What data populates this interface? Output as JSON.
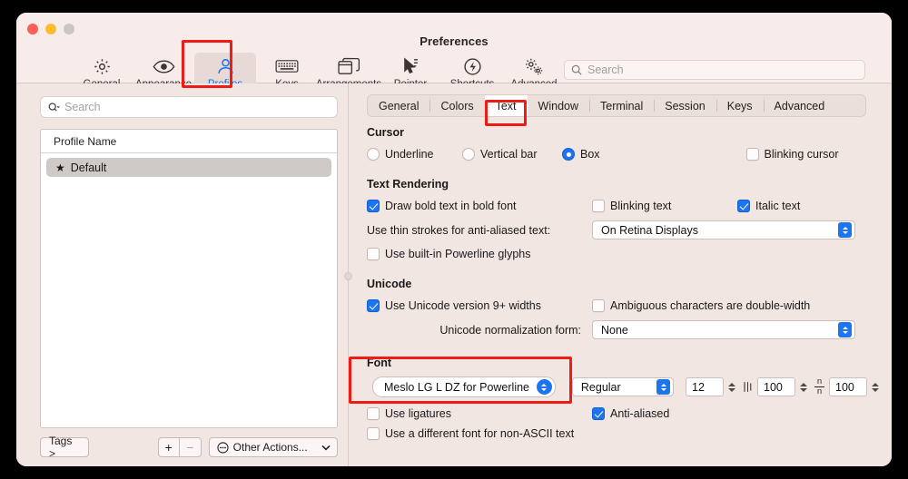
{
  "window": {
    "title": "Preferences",
    "traffic_lights": [
      "close",
      "minimize",
      "zoom"
    ]
  },
  "toolbar": {
    "items": [
      {
        "label": "General",
        "icon": "gear-icon",
        "selected": false
      },
      {
        "label": "Appearance",
        "icon": "eye-icon",
        "selected": false
      },
      {
        "label": "Profiles",
        "icon": "person-icon",
        "selected": true
      },
      {
        "label": "Keys",
        "icon": "keyboard-icon",
        "selected": false
      },
      {
        "label": "Arrangements",
        "icon": "windows-icon",
        "selected": false
      },
      {
        "label": "Pointer",
        "icon": "cursor-icon",
        "selected": false
      },
      {
        "label": "Shortcuts",
        "icon": "bolt-icon",
        "selected": false
      },
      {
        "label": "Advanced",
        "icon": "gears-icon",
        "selected": false
      }
    ],
    "search": {
      "placeholder": "Search",
      "value": "",
      "caption": "Search"
    }
  },
  "sidebar": {
    "search": {
      "placeholder": "Search",
      "value": ""
    },
    "table": {
      "column_header": "Profile Name",
      "rows": [
        {
          "name": "Default",
          "starred": true,
          "selected": true
        }
      ]
    },
    "buttons": {
      "tags": "Tags >",
      "add": "+",
      "remove": "−",
      "other_actions": "Other Actions..."
    }
  },
  "main": {
    "tabs": [
      {
        "label": "General",
        "active": false
      },
      {
        "label": "Colors",
        "active": false
      },
      {
        "label": "Text",
        "active": true
      },
      {
        "label": "Window",
        "active": false
      },
      {
        "label": "Terminal",
        "active": false
      },
      {
        "label": "Session",
        "active": false
      },
      {
        "label": "Keys",
        "active": false
      },
      {
        "label": "Advanced",
        "active": false
      }
    ],
    "cursor": {
      "title": "Cursor",
      "options": [
        {
          "label": "Underline",
          "checked": false
        },
        {
          "label": "Vertical bar",
          "checked": false
        },
        {
          "label": "Box",
          "checked": true
        }
      ],
      "blinking": {
        "label": "Blinking cursor",
        "checked": false
      }
    },
    "text_rendering": {
      "title": "Text Rendering",
      "bold": {
        "label": "Draw bold text in bold font",
        "checked": true
      },
      "blinking_text": {
        "label": "Blinking text",
        "checked": false
      },
      "italic_text": {
        "label": "Italic text",
        "checked": true
      },
      "thin_strokes": {
        "label": "Use thin strokes for anti-aliased text:",
        "value": "On Retina Displays"
      },
      "powerline": {
        "label": "Use built-in Powerline glyphs",
        "checked": false
      }
    },
    "unicode": {
      "title": "Unicode",
      "version9": {
        "label": "Use Unicode version 9+ widths",
        "checked": true
      },
      "ambiguous": {
        "label": "Ambiguous characters are double-width",
        "checked": false
      },
      "normalization": {
        "label": "Unicode normalization form:",
        "value": "None"
      }
    },
    "font": {
      "title": "Font",
      "family": "Meslo LG L DZ for Powerline",
      "style": "Regular",
      "size": "12",
      "vertical_spacing": "100",
      "vertical_spacing_icon": "vertical-spacing-icon",
      "horizontal_spacing": "100",
      "horizontal_spacing_icon": "horizontal-spacing-icon",
      "ligatures": {
        "label": "Use ligatures",
        "checked": false
      },
      "anti_aliased": {
        "label": "Anti-aliased",
        "checked": true
      },
      "non_ascii": {
        "label": "Use a different font for non-ASCII text",
        "checked": false
      }
    }
  },
  "annotations": {
    "color": "#ee1b16",
    "boxes": [
      "profiles-toolbar-item",
      "text-tab",
      "font-section"
    ]
  }
}
